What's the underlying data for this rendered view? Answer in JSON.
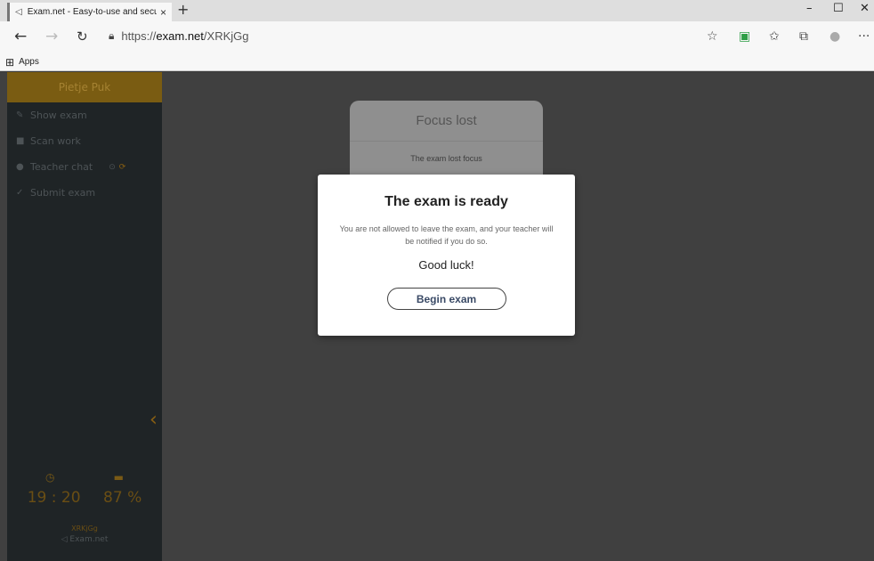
{
  "browser": {
    "tab_title": "Exam.net - Easy-to-use and secu",
    "tab_close": "×",
    "new_tab": "+",
    "url_scheme": "https://",
    "url_host": "exam.net",
    "url_path": "/XRKjGg",
    "bookmarks": {
      "apps_label": "Apps"
    },
    "window_controls": {
      "minimize": "–",
      "maximize": "☐",
      "close": "✕"
    },
    "tools": {
      "favorite": "☆",
      "extension": "▣",
      "favorites": "✩",
      "collections": "⧉",
      "profile": "●",
      "more": "···"
    }
  },
  "sidebar": {
    "user_name": "Pietje Puk",
    "items": [
      {
        "label": "Show exam",
        "icon": "edit-icon"
      },
      {
        "label": "Scan work",
        "icon": "camera-icon"
      },
      {
        "label": "Teacher chat",
        "icon": "chat-icon"
      },
      {
        "label": "Submit exam",
        "icon": "check-icon"
      }
    ],
    "collapse_glyph": "‹",
    "stats": {
      "time": "19 : 20",
      "battery": "87 %"
    },
    "exam_code": "XRKjGg",
    "logo_text": "Exam.net"
  },
  "focus_card": {
    "title": "Focus lost",
    "body": "The exam lost focus"
  },
  "modal": {
    "title": "The exam is ready",
    "text": "You are not allowed to leave the exam, and your teacher will be notified if you do so.",
    "luck": "Good luck!",
    "button": "Begin exam"
  },
  "colors": {
    "sidebar_bg": "#1f2426",
    "accent": "#7a5c12",
    "overlay": "#404040"
  }
}
